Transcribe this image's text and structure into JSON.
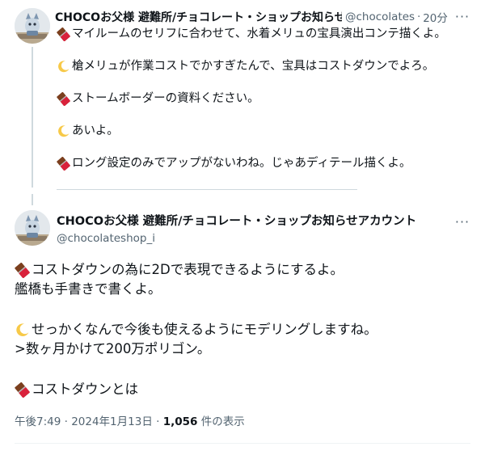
{
  "tweet1": {
    "display_name": "CHOCOお父様 避難所/チョコレート・ショップお知らせアカウント",
    "handle": "@chocolates",
    "separator": "·",
    "time": "20分",
    "more_icon": "ellipsis-icon",
    "lines": [
      {
        "icon": "chocolate-bar-icon",
        "text": "マイルームのセリフに合わせて、水着メリュの宝具演出コンテ描くよ。"
      },
      {
        "icon": "crescent-moon-icon",
        "text": "槍メリュが作業コストでかすぎたんで、宝具はコストダウンでよろ。"
      },
      {
        "icon": "chocolate-bar-icon",
        "text": "ストームボーダーの資料ください。"
      },
      {
        "icon": "crescent-moon-icon",
        "text": "あいよ。"
      },
      {
        "icon": "chocolate-bar-icon",
        "text": "ロング設定のみでアップがないわね。じゃあディテール描くよ。"
      }
    ]
  },
  "tweet2": {
    "display_name": "CHOCOお父様 避難所/チョコレート・ショップお知らせアカウント",
    "handle": "@chocolateshop_i",
    "more_icon": "ellipsis-icon",
    "lines": [
      {
        "icon": "chocolate-bar-icon",
        "text": "コストダウンの為に2Dで表現できるようにするよ。"
      },
      {
        "icon": "",
        "text": "艦橋も手書きで書くよ。"
      },
      {
        "gap": true
      },
      {
        "icon": "crescent-moon-icon",
        "text": "せっかくなんで今後も使えるようにモデリングしますね。"
      },
      {
        "icon": "",
        "text": ">数ヶ月かけて200万ポリゴン。"
      },
      {
        "gap": true
      },
      {
        "icon": "chocolate-bar-icon",
        "text": "コストダウンとは"
      }
    ],
    "meta": {
      "time": "午後7:49",
      "separator": " · ",
      "date": "2024年1月13日",
      "views": "1,056",
      "views_label": " 件の表示"
    }
  },
  "colors": {
    "text": "#0f1419",
    "secondary": "#536471",
    "thread_line": "#cfd9de",
    "divider": "#eff3f4"
  }
}
